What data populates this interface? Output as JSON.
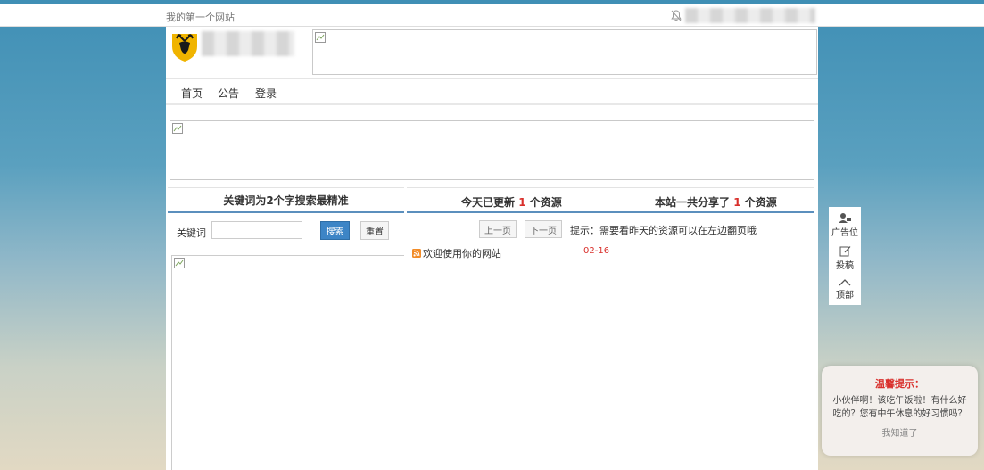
{
  "topbar": {
    "site_name": "我的第一个网站",
    "icon": "bell-slash-icon"
  },
  "header": {
    "logo_icon": "deer-logo-icon"
  },
  "nav": {
    "items": [
      "首页",
      "公告",
      "登录"
    ]
  },
  "search": {
    "title": "关键词为2个字搜索最精准",
    "label": "关键词",
    "input_value": "",
    "search_button": "搜索",
    "reset_button": "重置"
  },
  "stats": {
    "today_prefix": "今天已更新",
    "today_count": "1",
    "today_suffix": "个资源",
    "total_prefix": "本站一共分享了",
    "total_count": "1",
    "total_suffix": "个资源"
  },
  "pager": {
    "prev": "上一页",
    "next": "下一页",
    "tip": "提示：需要看昨天的资源可以在左边翻页哦"
  },
  "list": [
    {
      "title": "欢迎使用你的网站",
      "date": "02-16",
      "icon": "rss-icon"
    }
  ],
  "float_bar": {
    "ad": "广告位",
    "submit": "投稿",
    "top": "顶部"
  },
  "notice": {
    "title": "温馨提示：",
    "body": "小伙伴啊！该吃午饭啦！有什么好吃的？您有中午休息的好习惯吗？",
    "button": "我知道了"
  },
  "colors": {
    "accent": "#3d85c6",
    "highlight": "#d9302c",
    "border_blue": "#5b8fbd"
  }
}
